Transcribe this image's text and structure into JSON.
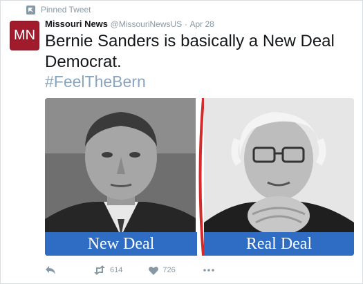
{
  "pinned_label": "Pinned Tweet",
  "avatar": {
    "text": "MN",
    "color": "#a01c2d"
  },
  "author": {
    "name": "Missouri News",
    "handle": "@MissouriNewsUS",
    "separator": "·",
    "date": "Apr 28"
  },
  "tweet_text": "Bernie Sanders is basically a New Deal Democrat.",
  "hashtag": "#FeelTheBern",
  "media": {
    "left_caption": "New Deal",
    "right_caption": "Real Deal",
    "caption_color": "#2f6cc4",
    "divider_color": "#d42a2a"
  },
  "actions": {
    "reply_icon": "reply-icon",
    "retweet_icon": "retweet-icon",
    "retweet_count": "614",
    "like_icon": "heart-icon",
    "like_count": "726",
    "more_icon": "more-icon"
  }
}
